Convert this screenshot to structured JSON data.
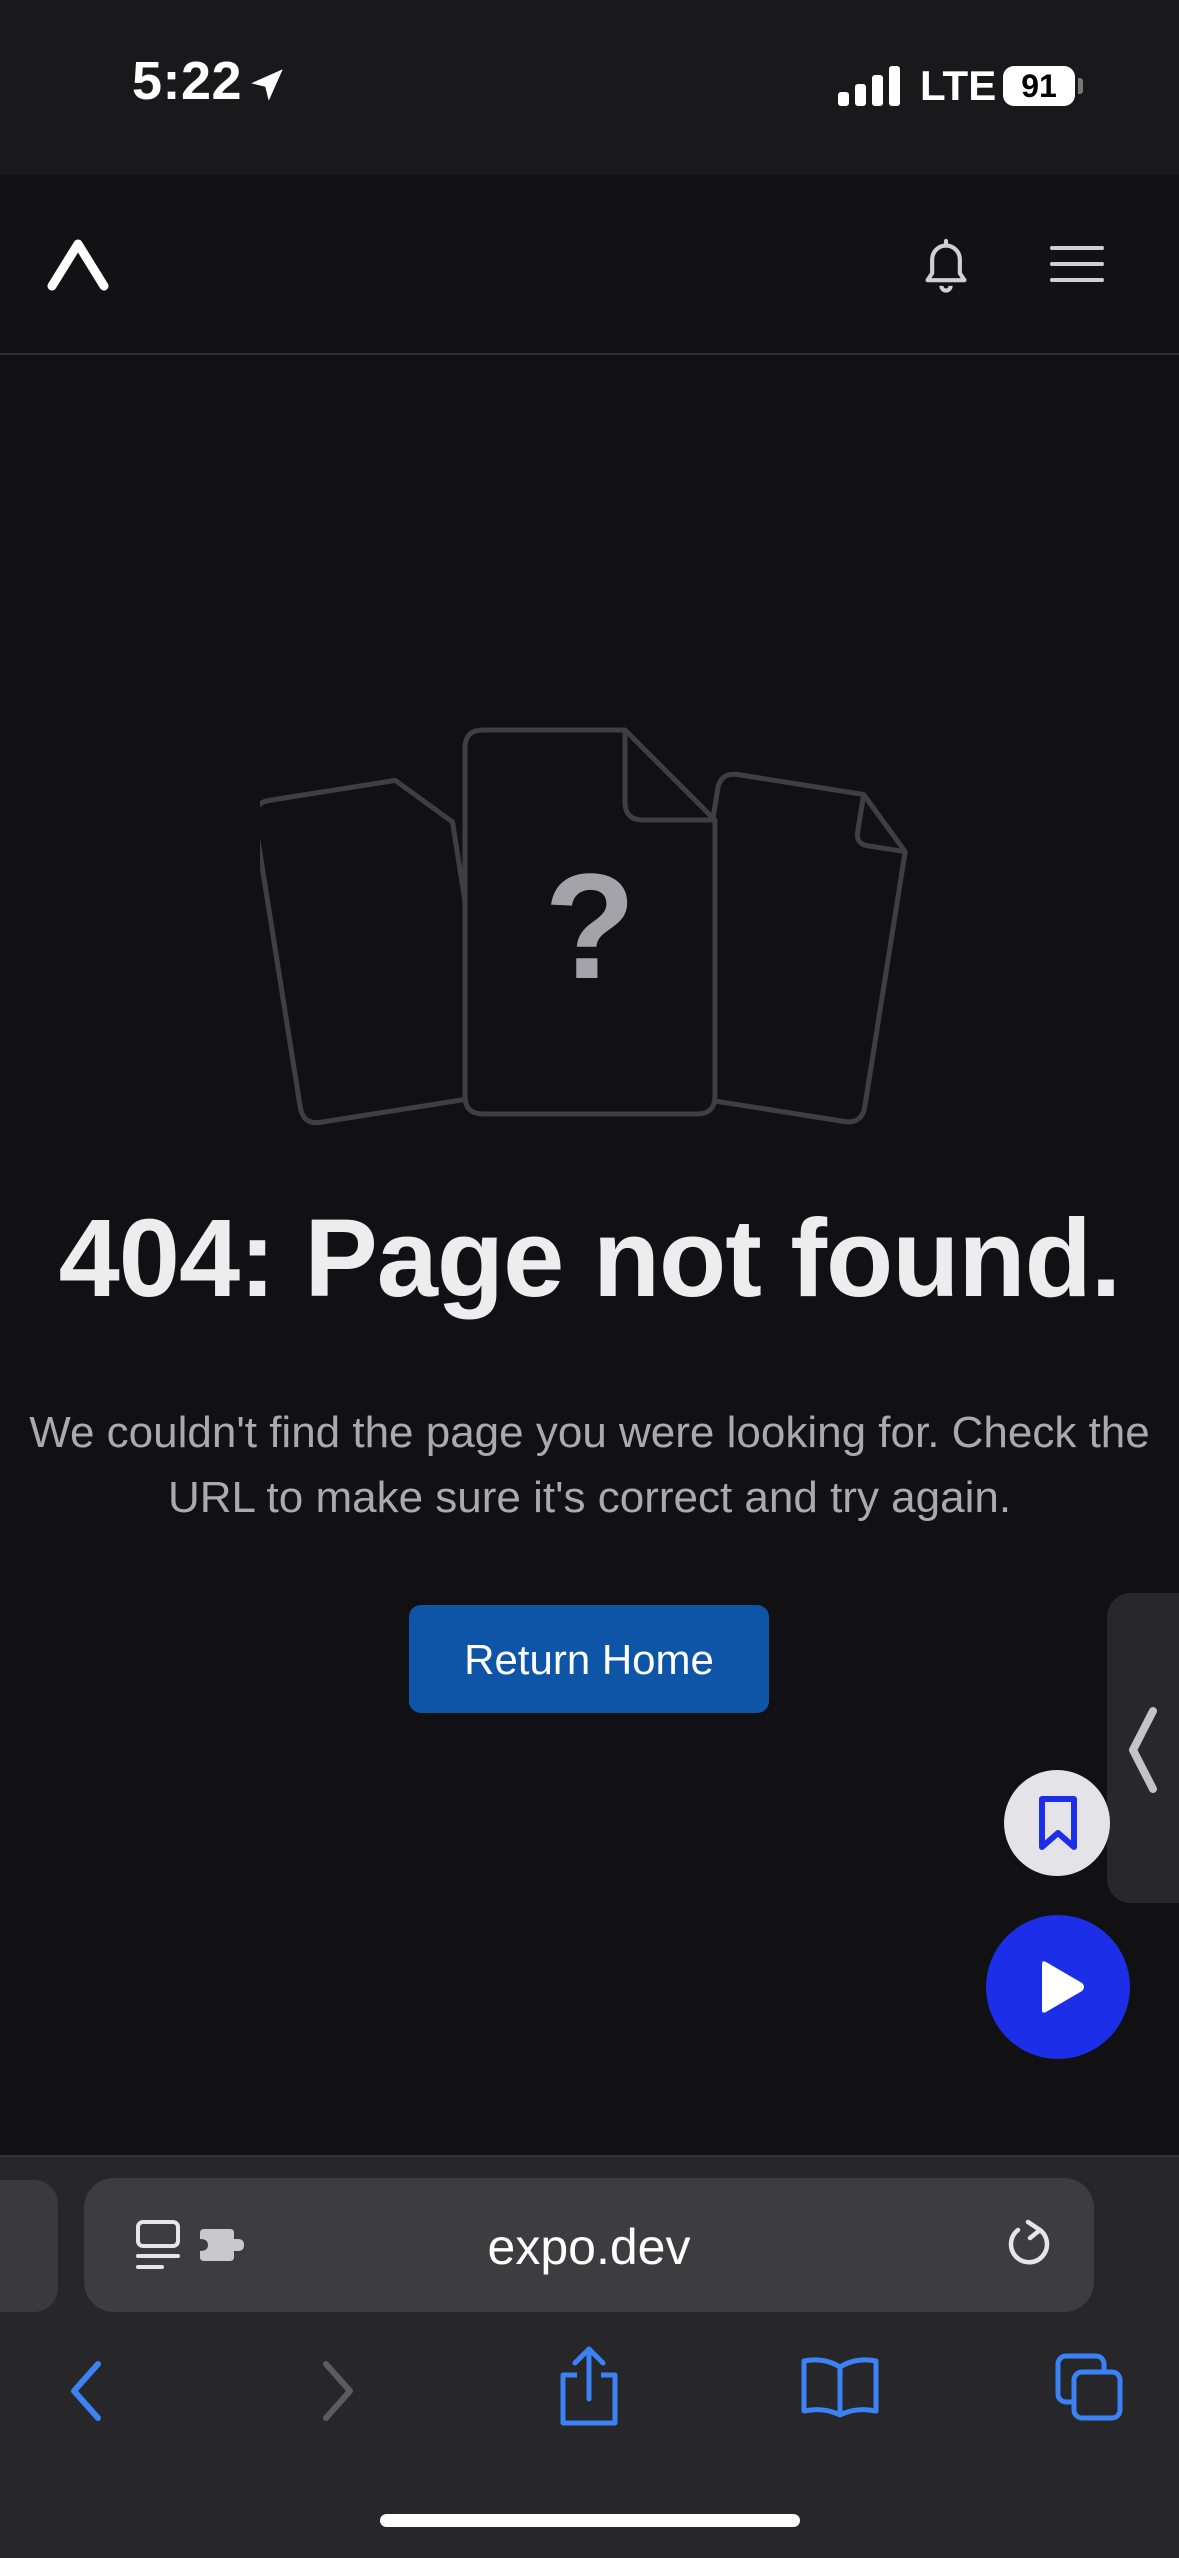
{
  "status_bar": {
    "time": "5:22",
    "network": "LTE",
    "battery": "91"
  },
  "header": {
    "logo": "expo-logo-icon",
    "icons": [
      "bell-icon",
      "hamburger-menu-icon"
    ]
  },
  "error": {
    "title": "404: Page not found.",
    "description": "We couldn't find the page you were looking for. Check the URL to make sure it's correct and try again.",
    "button_label": "Return Home",
    "illustration_glyph": "?"
  },
  "floating": {
    "icons": [
      "chevron-left-icon",
      "bookmark-icon",
      "play-icon"
    ]
  },
  "browser": {
    "url": "expo.dev",
    "toolbar_icons": [
      "back-icon",
      "forward-icon",
      "share-icon",
      "bookmarks-icon",
      "tabs-icon"
    ]
  },
  "colors": {
    "background": "#111114",
    "button": "#0e55a8",
    "play_button": "#1c2ee8",
    "link_blue": "#3b82f6"
  }
}
